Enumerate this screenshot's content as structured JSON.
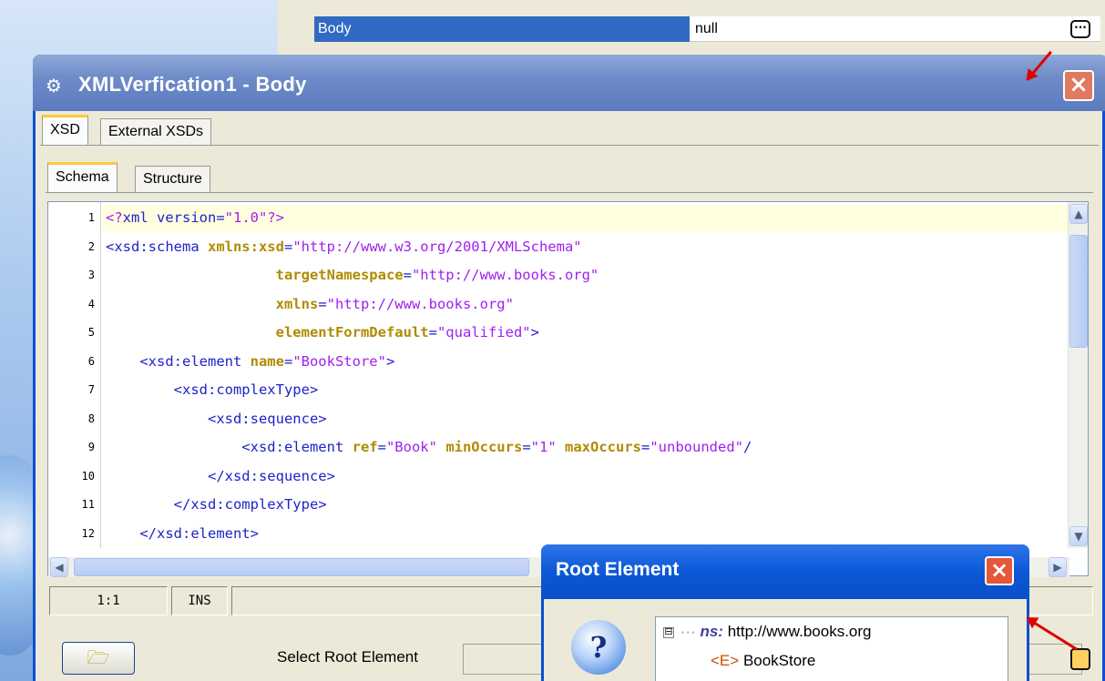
{
  "property_panel": {
    "name": "Body",
    "value": "null"
  },
  "window": {
    "title": "XMLVerfication1 - Body",
    "close_glyph": "×"
  },
  "outer_tabs": [
    {
      "label": "XSD",
      "active": true
    },
    {
      "label": "External XSDs",
      "active": false
    }
  ],
  "inner_tabs": [
    {
      "label": "Schema",
      "active": true
    },
    {
      "label": "Structure",
      "active": false
    }
  ],
  "editor": {
    "line_numbers": [
      "1",
      "2",
      "3",
      "4",
      "5",
      "6",
      "7",
      "8",
      "9",
      "10",
      "11",
      "12"
    ],
    "lines": [
      [
        {
          "t": "pi",
          "s": "<?"
        },
        {
          "t": "tag",
          "s": "xml version="
        },
        {
          "t": "val",
          "s": "\"1.0\""
        },
        {
          "t": "pi",
          "s": "?>"
        }
      ],
      [
        {
          "t": "tag",
          "s": "<xsd:schema "
        },
        {
          "t": "attr",
          "s": "xmlns:xsd"
        },
        {
          "t": "tag",
          "s": "="
        },
        {
          "t": "val",
          "s": "\"http://www.w3.org/2001/XMLSchema\""
        }
      ],
      [
        {
          "t": "tag",
          "s": "                    "
        },
        {
          "t": "attr",
          "s": "targetNamespace"
        },
        {
          "t": "tag",
          "s": "="
        },
        {
          "t": "val",
          "s": "\"http://www.books.org\""
        }
      ],
      [
        {
          "t": "tag",
          "s": "                    "
        },
        {
          "t": "attr",
          "s": "xmlns"
        },
        {
          "t": "tag",
          "s": "="
        },
        {
          "t": "val",
          "s": "\"http://www.books.org\""
        }
      ],
      [
        {
          "t": "tag",
          "s": "                    "
        },
        {
          "t": "attr",
          "s": "elementFormDefault"
        },
        {
          "t": "tag",
          "s": "="
        },
        {
          "t": "val",
          "s": "\"qualified\""
        },
        {
          "t": "tag",
          "s": ">"
        }
      ],
      [
        {
          "t": "tag",
          "s": "    <xsd:element "
        },
        {
          "t": "attr",
          "s": "name"
        },
        {
          "t": "tag",
          "s": "="
        },
        {
          "t": "val",
          "s": "\"BookStore\""
        },
        {
          "t": "tag",
          "s": ">"
        }
      ],
      [
        {
          "t": "tag",
          "s": "        <xsd:complexType>"
        }
      ],
      [
        {
          "t": "tag",
          "s": "            <xsd:sequence>"
        }
      ],
      [
        {
          "t": "tag",
          "s": "                <xsd:element "
        },
        {
          "t": "attr",
          "s": "ref"
        },
        {
          "t": "tag",
          "s": "="
        },
        {
          "t": "val",
          "s": "\"Book\""
        },
        {
          "t": "tag",
          "s": " "
        },
        {
          "t": "attr",
          "s": "minOccurs"
        },
        {
          "t": "tag",
          "s": "="
        },
        {
          "t": "val",
          "s": "\"1\""
        },
        {
          "t": "tag",
          "s": " "
        },
        {
          "t": "attr",
          "s": "maxOccurs"
        },
        {
          "t": "tag",
          "s": "="
        },
        {
          "t": "val",
          "s": "\"unbounded\""
        },
        {
          "t": "tag",
          "s": "/"
        }
      ],
      [
        {
          "t": "tag",
          "s": "            </xsd:sequence>"
        }
      ],
      [
        {
          "t": "tag",
          "s": "        </xsd:complexType>"
        }
      ],
      [
        {
          "t": "tag",
          "s": "    </xsd:element>"
        }
      ]
    ],
    "colors": {
      "tag": "#1e23c8",
      "attr": "#b08b00",
      "val": "#a020f0",
      "pi": "#a020f0"
    }
  },
  "status_bar": {
    "position": "1:1",
    "mode": "INS"
  },
  "footer": {
    "select_label": "Select Root Element",
    "select_value": ""
  },
  "root_dialog": {
    "title": "Root Element",
    "close_glyph": "×",
    "question_glyph": "?",
    "tree": {
      "expander": "⊟",
      "ns_label": "ns:",
      "ns_uri": "http://www.books.org",
      "elem_icon": "<E>",
      "elem_name": "BookStore"
    }
  },
  "icons": [
    "ellipsis-icon",
    "window-app-icon",
    "close-icon",
    "folder-icon",
    "question-icon",
    "scroll-up-icon",
    "scroll-down-icon",
    "scroll-left-icon",
    "scroll-right-icon"
  ]
}
